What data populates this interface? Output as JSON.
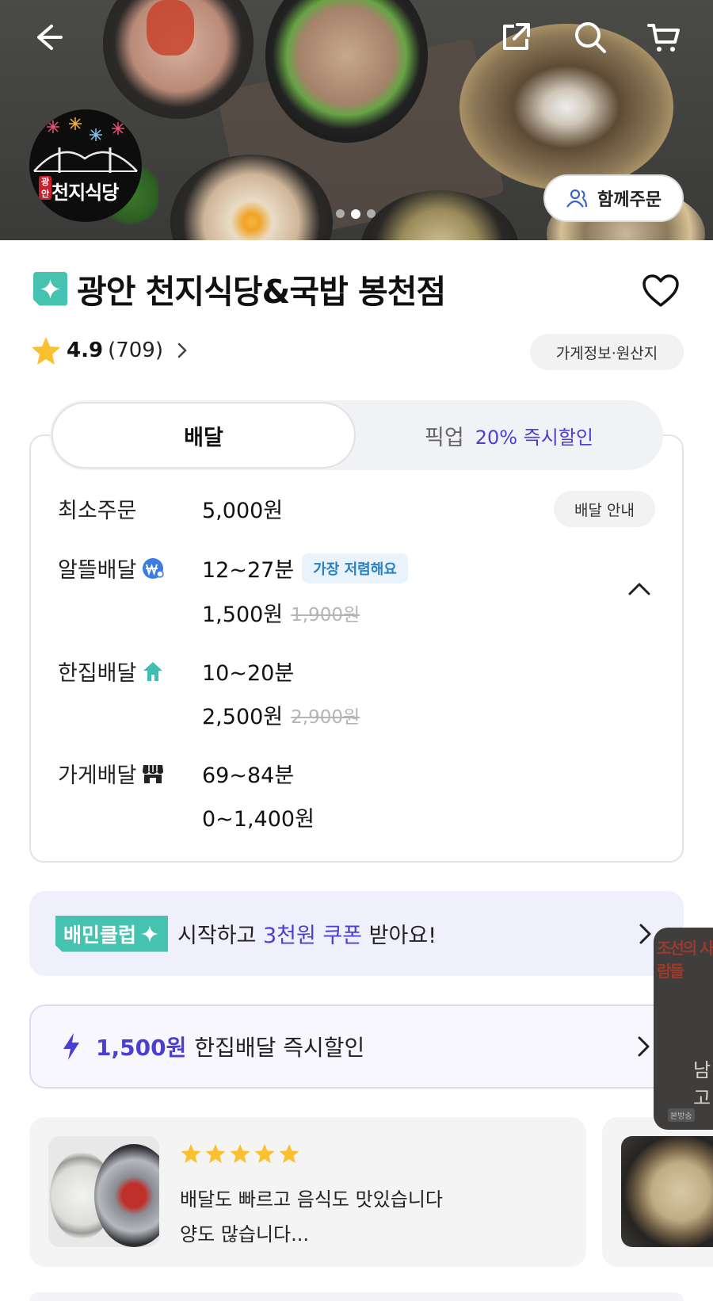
{
  "header": {
    "back_icon": "arrow-left-icon",
    "share_icon": "share-icon",
    "search_icon": "search-icon",
    "cart_icon": "cart-icon",
    "slide_count": 3,
    "active_slide": 2,
    "group_order_label": "함께주문"
  },
  "store_logo": {
    "text": "천지식당",
    "red_tag": "광안"
  },
  "store": {
    "name": "광안 천지식당&국밥 봉천점",
    "rating": "4.9",
    "review_count": "(709)",
    "info_button": "가게정보·원산지"
  },
  "order_tabs": {
    "delivery": "배달",
    "pickup": "픽업",
    "pickup_discount": "20% 즉시할인"
  },
  "delivery_info": {
    "min_order_label": "최소주문",
    "min_order_value": "5,000원",
    "guide_button": "배달 안내",
    "options": [
      {
        "label": "알뜰배달",
        "time": "12~27분",
        "badge": "가장 저렴해요",
        "fee": "1,500원",
        "original_fee": "1,900원"
      },
      {
        "label": "한집배달",
        "time": "10~20분",
        "fee": "2,500원",
        "original_fee": "2,900원"
      },
      {
        "label": "가게배달",
        "time": "69~84분",
        "fee": "0~1,400원"
      }
    ]
  },
  "club_banner": {
    "tag": "배민클럽",
    "text_prefix": "시작하고 ",
    "highlight": "3천원 쿠폰",
    "text_suffix": " 받아요!"
  },
  "discount_banner": {
    "amount": "1,500원",
    "text": "한집배달 즉시할인"
  },
  "review": {
    "stars": 5,
    "line1": "배달도 빠르고 음식도 맛있습니다",
    "line2": "양도 많습니다..."
  },
  "floating_video": {
    "title": "조선의 사람들",
    "mid": "남 고",
    "footer": "본방송"
  },
  "colors": {
    "accent_purple": "#4b3fd0",
    "club_teal": "#45c2b0",
    "star_yellow": "#fbc02d",
    "badge_blue": "#2b80c4"
  }
}
